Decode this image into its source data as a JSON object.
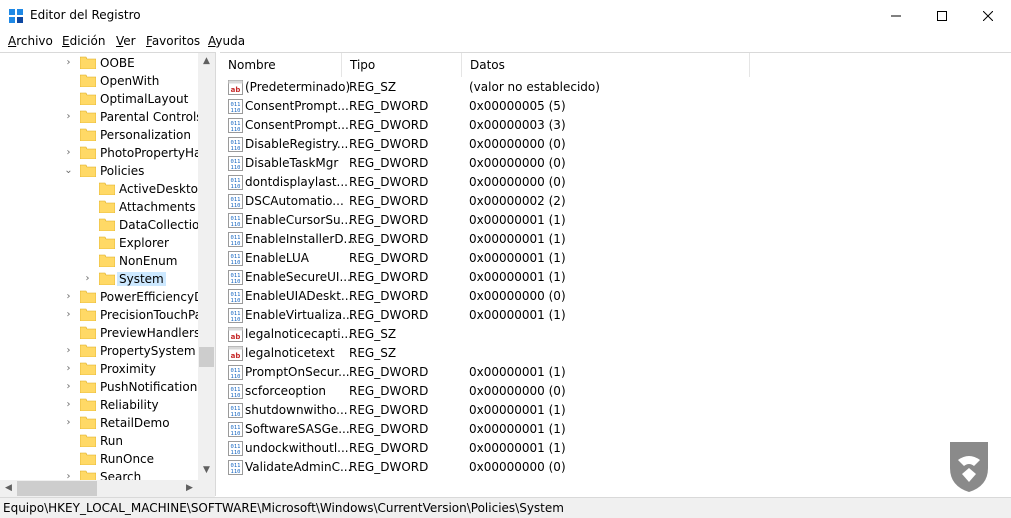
{
  "window": {
    "title": "Editor del Registro"
  },
  "menu": [
    {
      "mnemonic": "A",
      "rest": "rchivo"
    },
    {
      "mnemonic": "E",
      "rest": "dición"
    },
    {
      "mnemonic": "V",
      "rest": "er"
    },
    {
      "mnemonic": "F",
      "rest": "avoritos"
    },
    {
      "mnemonic": "A",
      "rest": "yuda"
    }
  ],
  "tree": {
    "items": [
      {
        "label": "OOBE",
        "expander": "›"
      },
      {
        "label": "OpenWith",
        "expander": ""
      },
      {
        "label": "OptimalLayout",
        "expander": ""
      },
      {
        "label": "Parental Controls",
        "expander": "›"
      },
      {
        "label": "Personalization",
        "expander": ""
      },
      {
        "label": "PhotoPropertyHan",
        "expander": "›"
      },
      {
        "label": "Policies",
        "expander": "⌄"
      },
      {
        "label": "ActiveDesktop",
        "expander": ""
      },
      {
        "label": "Attachments",
        "expander": ""
      },
      {
        "label": "DataCollection",
        "expander": ""
      },
      {
        "label": "Explorer",
        "expander": ""
      },
      {
        "label": "NonEnum",
        "expander": ""
      },
      {
        "label": "System",
        "expander": "›",
        "selected": true
      },
      {
        "label": "PowerEfficiencyDia",
        "expander": "›"
      },
      {
        "label": "PrecisionTouchPac",
        "expander": "›"
      },
      {
        "label": "PreviewHandlers",
        "expander": ""
      },
      {
        "label": "PropertySystem",
        "expander": "›"
      },
      {
        "label": "Proximity",
        "expander": "›"
      },
      {
        "label": "PushNotifications",
        "expander": "›"
      },
      {
        "label": "Reliability",
        "expander": "›"
      },
      {
        "label": "RetailDemo",
        "expander": "›"
      },
      {
        "label": "Run",
        "expander": ""
      },
      {
        "label": "RunOnce",
        "expander": ""
      },
      {
        "label": "Search",
        "expander": "›"
      }
    ]
  },
  "columns": {
    "name": "Nombre",
    "type": "Tipo",
    "data": "Datos"
  },
  "values": [
    {
      "name": "(Predeterminado)",
      "type": "REG_SZ",
      "data": "(valor no establecido)",
      "kind": "sz"
    },
    {
      "name": "ConsentPrompt...",
      "type": "REG_DWORD",
      "data": "0x00000005 (5)",
      "kind": "dword"
    },
    {
      "name": "ConsentPrompt...",
      "type": "REG_DWORD",
      "data": "0x00000003 (3)",
      "kind": "dword"
    },
    {
      "name": "DisableRegistry...",
      "type": "REG_DWORD",
      "data": "0x00000000 (0)",
      "kind": "dword"
    },
    {
      "name": "DisableTaskMgr",
      "type": "REG_DWORD",
      "data": "0x00000000 (0)",
      "kind": "dword"
    },
    {
      "name": "dontdisplaylast...",
      "type": "REG_DWORD",
      "data": "0x00000000 (0)",
      "kind": "dword"
    },
    {
      "name": "DSCAutomatio...",
      "type": "REG_DWORD",
      "data": "0x00000002 (2)",
      "kind": "dword"
    },
    {
      "name": "EnableCursorSu...",
      "type": "REG_DWORD",
      "data": "0x00000001 (1)",
      "kind": "dword"
    },
    {
      "name": "EnableInstallerD...",
      "type": "REG_DWORD",
      "data": "0x00000001 (1)",
      "kind": "dword"
    },
    {
      "name": "EnableLUA",
      "type": "REG_DWORD",
      "data": "0x00000001 (1)",
      "kind": "dword"
    },
    {
      "name": "EnableSecureUI...",
      "type": "REG_DWORD",
      "data": "0x00000001 (1)",
      "kind": "dword"
    },
    {
      "name": "EnableUIADeskt...",
      "type": "REG_DWORD",
      "data": "0x00000000 (0)",
      "kind": "dword"
    },
    {
      "name": "EnableVirtualiza...",
      "type": "REG_DWORD",
      "data": "0x00000001 (1)",
      "kind": "dword"
    },
    {
      "name": "legalnoticecapti...",
      "type": "REG_SZ",
      "data": "",
      "kind": "sz"
    },
    {
      "name": "legalnoticetext",
      "type": "REG_SZ",
      "data": "",
      "kind": "sz"
    },
    {
      "name": "PromptOnSecur...",
      "type": "REG_DWORD",
      "data": "0x00000001 (1)",
      "kind": "dword"
    },
    {
      "name": "scforceoption",
      "type": "REG_DWORD",
      "data": "0x00000000 (0)",
      "kind": "dword"
    },
    {
      "name": "shutdownwitho...",
      "type": "REG_DWORD",
      "data": "0x00000001 (1)",
      "kind": "dword"
    },
    {
      "name": "SoftwareSASGe...",
      "type": "REG_DWORD",
      "data": "0x00000001 (1)",
      "kind": "dword"
    },
    {
      "name": "undockwithoutl...",
      "type": "REG_DWORD",
      "data": "0x00000001 (1)",
      "kind": "dword"
    },
    {
      "name": "ValidateAdminC...",
      "type": "REG_DWORD",
      "data": "0x00000000 (0)",
      "kind": "dword"
    }
  ],
  "status": {
    "path": "Equipo\\HKEY_LOCAL_MACHINE\\SOFTWARE\\Microsoft\\Windows\\CurrentVersion\\Policies\\System"
  },
  "colors": {
    "folder": "#ffd966",
    "selection": "#cce8ff",
    "watermark": "#8a8a8a"
  }
}
